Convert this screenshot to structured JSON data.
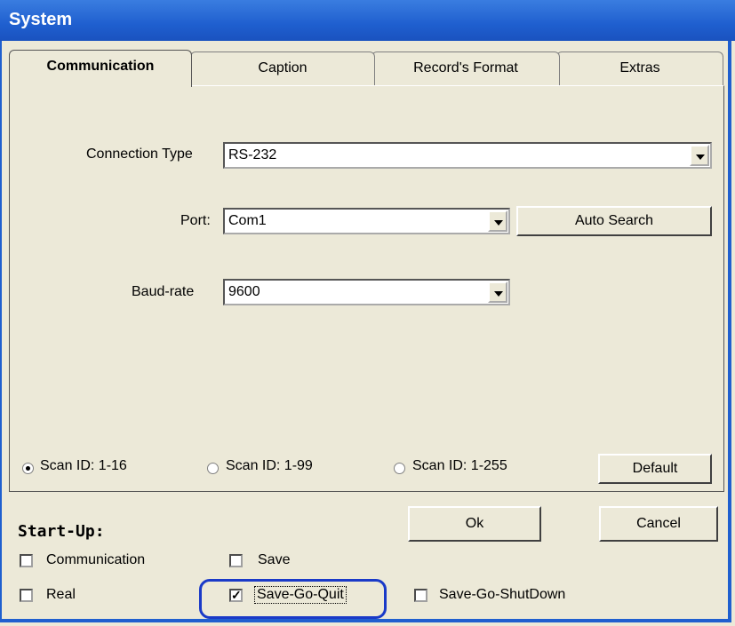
{
  "window": {
    "title": "System"
  },
  "tabs": [
    {
      "label": "Communication",
      "active": true
    },
    {
      "label": "Caption",
      "active": false
    },
    {
      "label": "Record's Format",
      "active": false
    },
    {
      "label": "Extras",
      "active": false
    }
  ],
  "communication": {
    "connection_type_label": "Connection Type",
    "connection_type_value": "RS-232",
    "port_label": "Port:",
    "port_value": "Com1",
    "auto_search_label": "Auto Search",
    "baud_label": "Baud-rate",
    "baud_value": "9600"
  },
  "scan": {
    "options": [
      {
        "label": "Scan ID: 1-16",
        "selected": true
      },
      {
        "label": "Scan ID: 1-99",
        "selected": false
      },
      {
        "label": "Scan ID: 1-255",
        "selected": false
      }
    ],
    "default_label": "Default"
  },
  "startup": {
    "heading": "Start-Up:",
    "options": [
      {
        "label": "Communication",
        "checked": false
      },
      {
        "label": "Save",
        "checked": false
      },
      {
        "label": "Real",
        "checked": false
      },
      {
        "label": "Save-Go-Quit",
        "checked": true
      },
      {
        "label": "Save-Go-ShutDown",
        "checked": false
      }
    ]
  },
  "buttons": {
    "ok": "Ok",
    "cancel": "Cancel"
  },
  "colors": {
    "titlebar": "#1f5fcf",
    "highlight": "#1a3ac8",
    "face": "#ece9d8"
  }
}
